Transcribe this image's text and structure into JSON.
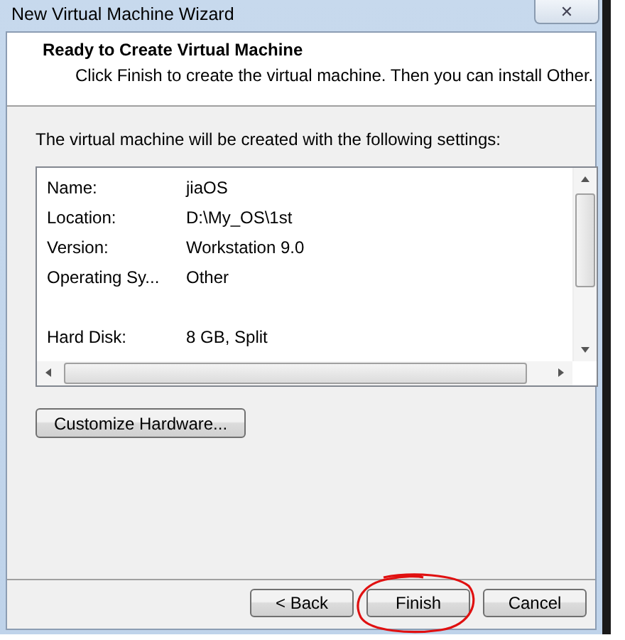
{
  "window": {
    "title": "New Virtual Machine Wizard",
    "close_symbol": "✕"
  },
  "header": {
    "title": "Ready to Create Virtual Machine",
    "subtitle": "Click Finish to create the virtual machine. Then you can install Other."
  },
  "intro": "The virtual machine will be created with the following settings:",
  "settings": {
    "groups": [
      [
        {
          "label": "Name:",
          "value": "jiaOS"
        },
        {
          "label": "Location:",
          "value": "D:\\My_OS\\1st"
        },
        {
          "label": "Version:",
          "value": "Workstation 9.0"
        },
        {
          "label": "Operating Sy...",
          "value": "Other"
        }
      ],
      [
        {
          "label": "Hard Disk:",
          "value": "8 GB, Split"
        }
      ]
    ]
  },
  "customize_button": "Customize Hardware...",
  "buttons": [
    {
      "label": "< Back",
      "circled": false
    },
    {
      "label": "Finish",
      "circled": true
    },
    {
      "label": "Cancel",
      "circled": false
    }
  ]
}
